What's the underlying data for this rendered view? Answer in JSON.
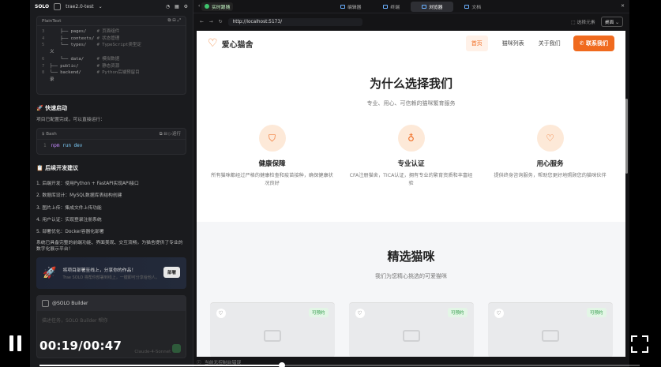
{
  "ide": {
    "brand": "SOLO",
    "project": "trae2.0-test",
    "code_lang": "PlainText",
    "tree": [
      {
        "n": "3",
        "t": "    ├── pages/",
        "c": "# 页面组件"
      },
      {
        "n": "4",
        "t": "    ├── contexts/",
        "c": "# 状态管理"
      },
      {
        "n": "5",
        "t": "    └── types/",
        "c": "# TypeScript类型定"
      },
      {
        "n": "",
        "t": "义",
        "c": ""
      },
      {
        "n": "6",
        "t": "    └── data/",
        "c": "# 模拟数据"
      },
      {
        "n": "7",
        "t": "├── public/",
        "c": "# 静态资源"
      },
      {
        "n": "8",
        "t": "└── backend/",
        "c": "# Python后端预留目"
      },
      {
        "n": "",
        "t": "录",
        "c": ""
      }
    ],
    "quick_start": "🚀 快速启动",
    "quick_desc": "项目已配置完成，可以直接运行：",
    "bash_label": "Bash",
    "run_label": "运行",
    "cmd_num": "1",
    "cmd_npm": "npm",
    "cmd_rest": "run dev",
    "next_title": "📋 后续开发建议",
    "steps": [
      "1. 后端开发：使用Python + FastAPI实现API接口",
      "2. 数据库设计：MySQL数据库表结构创建",
      "3. 图片上传：集成文件上传功能",
      "4. 用户认证：实现登录注册系统",
      "5. 部署优化：Docker容器化部署"
    ],
    "summary": "系统已具备完整的前端功能、界面美观、交互流畅，为猫舍提供了专业的数字化展示平台！",
    "promo_title": "将项目部署至线上，分享你的作品！",
    "promo_sub": "Trae SOLO 将帮你部署到线上，一键即可分享给他人。",
    "promo_btn": "部署",
    "chat_title": "@SOLO Builder",
    "chat_placeholder": "描述任务，SOLO Builder 帮你",
    "chat_footer": "Claude-4-Sonnet",
    "chat_tools": "@  #  ⊞"
  },
  "browser": {
    "live_label": "实时跟随",
    "tabs": [
      "编辑器",
      "终端",
      "浏览器",
      "文档"
    ],
    "active_tab": "浏览器",
    "url": "http://localhost:5173/",
    "select_btn": "选择元素",
    "dropdown": "桌面",
    "status": "当前无控制台错误"
  },
  "site": {
    "name": "爱心猫舍",
    "nav": [
      "首页",
      "猫咪列表",
      "关于我们"
    ],
    "nav_active": "首页",
    "cta": "联系我们",
    "why_title": "为什么选择我们",
    "why_sub": "专业、用心、可信赖的猫咪繁育服务",
    "features": [
      {
        "title": "健康保障",
        "desc": "所有猫咪都经过严格的健康检查和疫苗接种，确保健康状况良好",
        "icon": "shield-icon"
      },
      {
        "title": "专业认证",
        "desc": "CFA注册猫舍，TICA认证，拥有专业的繁育资质和丰富经验",
        "icon": "award-icon"
      },
      {
        "title": "用心服务",
        "desc": "提供终身咨询服务，帮助您更好地照顾您的猫咪伙伴",
        "icon": "heart-icon"
      }
    ],
    "sel_title": "精选猫咪",
    "sel_sub": "我们为您精心挑选的可爱猫咪",
    "badge": "可预约"
  },
  "player": {
    "time": "00:19/00:47",
    "progress": 0.404
  }
}
